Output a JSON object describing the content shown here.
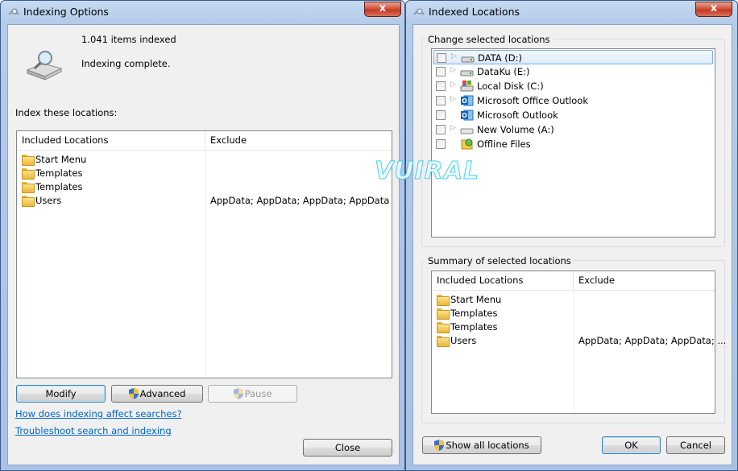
{
  "indexing_window": {
    "title": "Indexing Options",
    "close_glyph": "x",
    "items_indexed": "1.041 items indexed",
    "status": "Indexing complete.",
    "index_these_label": "Index these locations:",
    "columns": [
      "Included Locations",
      "Exclude"
    ],
    "locations": [
      {
        "name": "Start Menu",
        "exclude": ""
      },
      {
        "name": "Templates",
        "exclude": ""
      },
      {
        "name": "Templates",
        "exclude": ""
      },
      {
        "name": "Users",
        "exclude": "AppData; AppData; AppData; AppData"
      }
    ],
    "buttons": {
      "modify": "Modify",
      "advanced": "Advanced",
      "pause": "Pause",
      "close": "Close"
    },
    "links": {
      "how": "How does indexing affect searches?",
      "troubleshoot": "Troubleshoot search and indexing"
    }
  },
  "locations_window": {
    "title": "Indexed Locations",
    "close_glyph": "x",
    "change_label": "Change selected locations",
    "tree": [
      {
        "label": "DATA (D:)",
        "icon": "drive-icon",
        "expander": true,
        "selected": true
      },
      {
        "label": "DataKu (E:)",
        "icon": "drive-icon",
        "expander": true,
        "selected": false
      },
      {
        "label": "Local Disk (C:)",
        "icon": "system-drive-icon",
        "expander": true,
        "selected": false
      },
      {
        "label": "Microsoft Office Outlook",
        "icon": "outlook-icon",
        "expander": true,
        "selected": false
      },
      {
        "label": "Microsoft Outlook",
        "icon": "outlook-icon",
        "expander": false,
        "selected": false
      },
      {
        "label": "New Volume (A:)",
        "icon": "drive-icon",
        "expander": true,
        "selected": false
      },
      {
        "label": "Offline Files",
        "icon": "offline-files-icon",
        "expander": false,
        "selected": false
      }
    ],
    "summary_label": "Summary of selected locations",
    "columns": [
      "Included Locations",
      "Exclude"
    ],
    "summary": [
      {
        "name": "Start Menu",
        "exclude": ""
      },
      {
        "name": "Templates",
        "exclude": ""
      },
      {
        "name": "Templates",
        "exclude": ""
      },
      {
        "name": "Users",
        "exclude": "AppData; AppData; AppData; ..."
      }
    ],
    "buttons": {
      "show_all": "Show all locations",
      "ok": "OK",
      "cancel": "Cancel"
    }
  },
  "watermark": "VUIRAL",
  "colors": {
    "link": "#0066cc",
    "title_gradient": "#b4cbe9",
    "close_button": "#c33a1f"
  }
}
